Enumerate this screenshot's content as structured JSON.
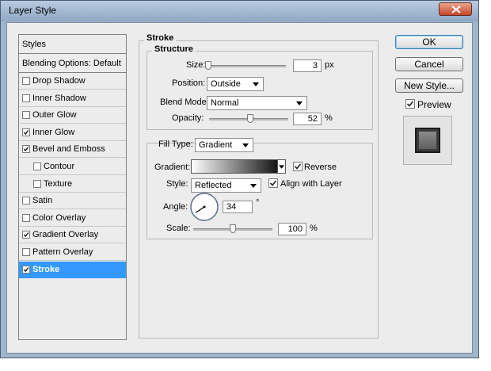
{
  "window": {
    "title": "Layer Style"
  },
  "sidebar": {
    "header": "Styles",
    "blending": "Blending Options: Default",
    "items": [
      {
        "label": "Drop Shadow",
        "checked": false
      },
      {
        "label": "Inner Shadow",
        "checked": false
      },
      {
        "label": "Outer Glow",
        "checked": false
      },
      {
        "label": "Inner Glow",
        "checked": true
      },
      {
        "label": "Bevel and Emboss",
        "checked": true
      },
      {
        "label": "Contour",
        "checked": false
      },
      {
        "label": "Texture",
        "checked": false
      },
      {
        "label": "Satin",
        "checked": false
      },
      {
        "label": "Color Overlay",
        "checked": false
      },
      {
        "label": "Gradient Overlay",
        "checked": true
      },
      {
        "label": "Pattern Overlay",
        "checked": false
      },
      {
        "label": "Stroke",
        "checked": true
      }
    ]
  },
  "panel": {
    "title": "Stroke",
    "structure": {
      "title": "Structure",
      "size_label": "Size:",
      "size_value": "3",
      "size_unit": "px",
      "size_level": 0.02,
      "position_label": "Position:",
      "position_value": "Outside",
      "blend_label": "Blend Mode:",
      "blend_value": "Normal",
      "opacity_label": "Opacity:",
      "opacity_value": "52",
      "opacity_unit": "%",
      "opacity_level": 0.52
    },
    "fill": {
      "filltype_label": "Fill Type:",
      "filltype_value": "Gradient",
      "gradient_label": "Gradient:",
      "reverse_label": "Reverse",
      "reverse_checked": true,
      "style_label": "Style:",
      "style_value": "Reflected",
      "align_label": "Align with Layer",
      "align_checked": true,
      "angle_label": "Angle:",
      "angle_value": "34",
      "angle_unit": "°",
      "scale_label": "Scale:",
      "scale_value": "100",
      "scale_unit": "%",
      "scale_level": 0.5
    }
  },
  "buttons": {
    "ok": "OK",
    "cancel": "Cancel",
    "new_style": "New Style...",
    "preview": "Preview",
    "preview_checked": true
  },
  "colors": {
    "selection": "#3399ff",
    "titlebar": "#9fb6cc",
    "close": "#c5472c"
  },
  "icons": [
    "close-icon",
    "dropdown-arrow-icon",
    "checkmark-icon",
    "angle-dial-icon"
  ]
}
